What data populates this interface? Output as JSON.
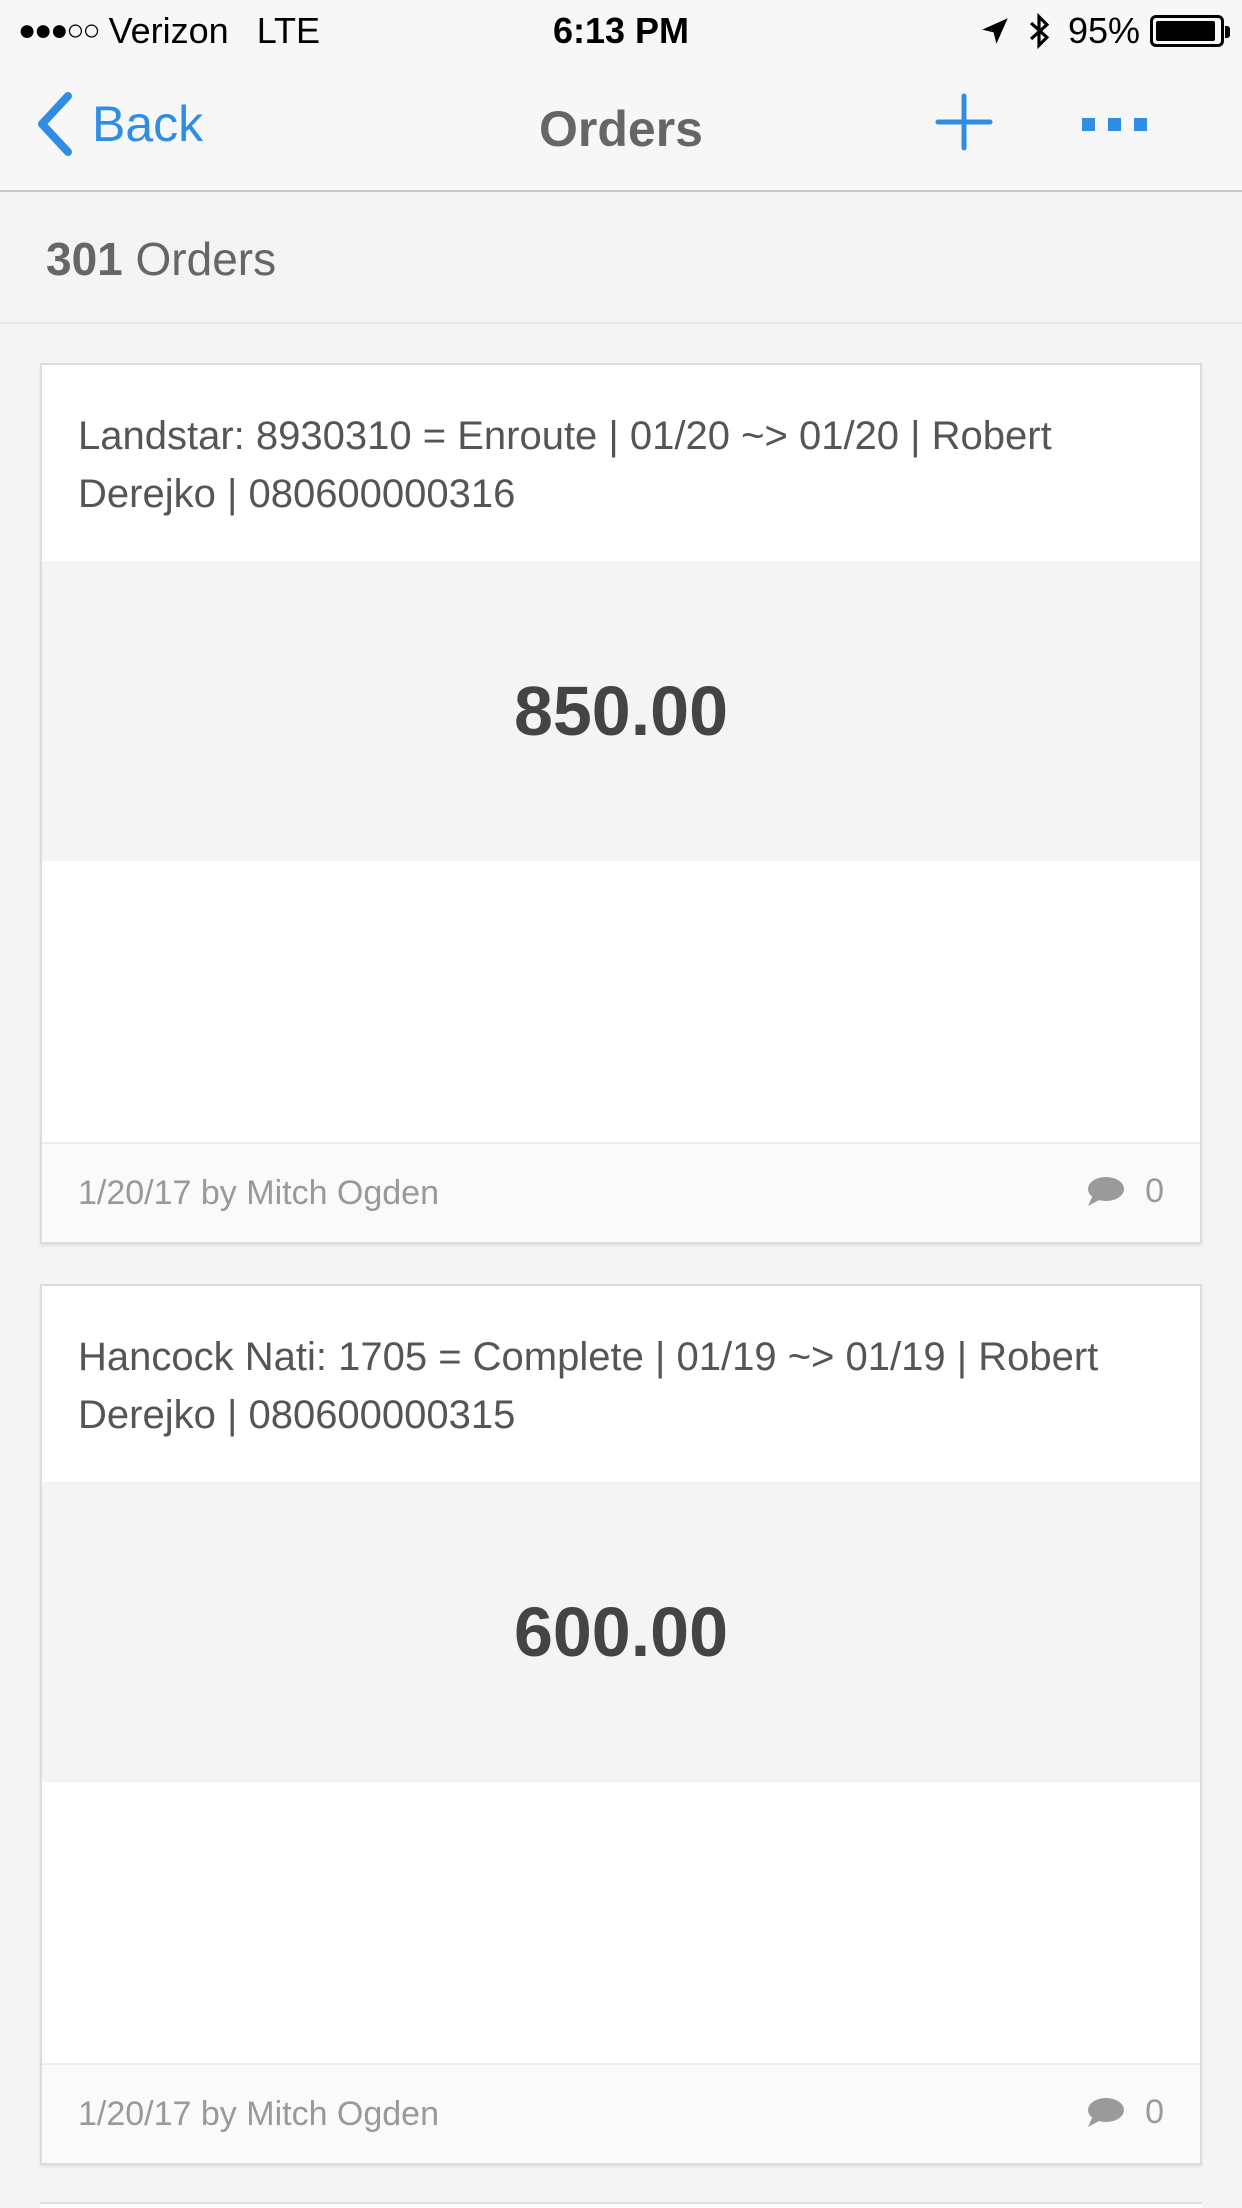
{
  "status_bar": {
    "signal": "●●●○○",
    "carrier": "Verizon",
    "network": "LTE",
    "time": "6:13 PM",
    "battery_percent": "95%",
    "battery_level": 0.95
  },
  "nav": {
    "back_label": "Back",
    "title": "Orders"
  },
  "summary": {
    "count": "301",
    "count_label": "Orders"
  },
  "orders": [
    {
      "title": "Landstar: 8930310 = Enroute | 01/20 ~> 01/20 | Robert Derejko | 080600000316",
      "amount": "850.00",
      "meta": "1/20/17 by Mitch Ogden",
      "comment_count": "0"
    },
    {
      "title": "Hancock Nati: 1705 = Complete | 01/19 ~> 01/19 | Robert Derejko | 080600000315",
      "amount": "600.00",
      "meta": "1/20/17 by Mitch Ogden",
      "comment_count": "0"
    }
  ],
  "colors": {
    "accent": "#2f8de4",
    "background": "#f4f4f4"
  }
}
